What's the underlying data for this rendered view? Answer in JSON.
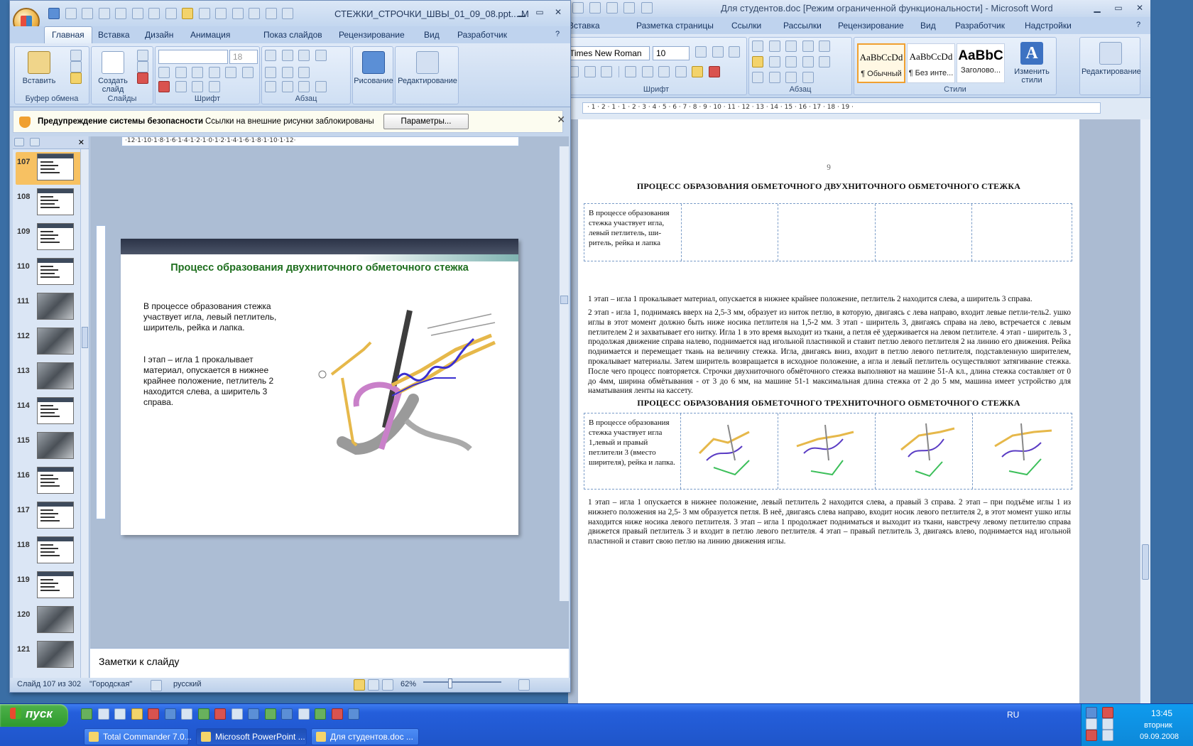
{
  "word": {
    "title": "Для студентов.doc [Режим ограниченной функциональности] - Microsoft Word",
    "tabs": [
      "Вставка",
      "Разметка страницы",
      "Ссылки",
      "Рассылки",
      "Рецензирование",
      "Вид",
      "Разработчик",
      "Надстройки"
    ],
    "font_name": "Times New Roman",
    "font_size": "10",
    "styles": [
      {
        "sample": "AaBbCcDd",
        "name": "¶ Обычный"
      },
      {
        "sample": "AaBbCcDd",
        "name": "¶ Без инте..."
      },
      {
        "sample": "AaBbC",
        "name": "Заголово..."
      }
    ],
    "change_styles": "Изменить стили",
    "editing": "Редактирование",
    "groups": {
      "font": "Шрифт",
      "paragraph": "Абзац",
      "styles": "Стили"
    },
    "ruler": "· 1 · 2 · 1 · 1 · 2 · 3 · 4 · 5 · 6 · 7 · 8 · 9 · 10 · 11 · 12 · 13 · 14 · 15 · 16 · 17 · 18 · 19 ·",
    "page_number": "9",
    "heading1": "ПРОЦЕСС ОБРАЗОВАНИЯ ОБМЕТОЧНОГО ДВУХНИТОЧНОГО ОБМЕТОЧНОГО СТЕЖКА",
    "table1_text": "В процессе образования стежка участвует игла, левый петлитель, ши-ритель, рейка и лапка",
    "para1": "1 этап – игла 1 прокалывает материал, опускается в нижнее крайнее положение, петлитель 2 находится слева, а ширитель 3 справа.",
    "para2": "2 этап - игла 1, поднимаясь вверх на 2,5-3 мм, образует из ниток петлю, в которую, двигаясь с лева направо, входит левые петли-тель2. ушко иглы в этот момент должно быть ниже носика петлителя на 1,5-2 мм. 3 этап - ширитель 3, двигаясь справа на лево, встречается с левым петлителем 2 и захватывает его нитку. Игла 1 в это время выходит из ткани, а петля её удерживается на левом петлителе. 4 этап - ширитель 3 , продолжая движение справа налево, поднимается над игольной пластинкой и ставит петлю левого петлителя 2 на линию его движения. Рейка поднимается и перемещает ткань на величину стежка. Игла, двигаясь вниз, входит в петлю левого петлителя, подставленную ширителем, прокалывает материалы. Затем ширитель возвращается в исходное положение, а игла и левый петлитель осуществляют затягивание стежка. После чего процесс повторяется. Строчки двухниточного обмёточного стежка выполняют на машине 51-А кл., длина стежка составляет от 0 до 4мм, ширина обмётывания - от 3 до 6 мм, на машине 51-1 максимальная длина стежка от 2 до 5 мм, машина имеет устройство для наматывания ленты на кассету.",
    "heading2": "ПРОЦЕСС ОБРАЗОВАНИЯ ОБМЕТОЧНОГО ТРЕХНИТОЧНОГО ОБМЕТОЧНОГО СТЕЖКА",
    "table2_text": "В процессе образования стежка участвует игла 1,левый и правый петлители 3 (вместо ширителя), рейка и лапка.",
    "para3": "1 этап – игла 1 опускается в нижнее положение, левый петлитель 2 находится слева, а правый 3 справа. 2 этап – при подъёме иглы 1 из нижнего положения на 2,5- 3 мм образуется петля. В неё, двигаясь слева направо, входит носик левого петлителя 2, в этот момент ушко иглы находится ниже носика левого петлителя. 3 этап – игла 1 продолжает подниматься и выходит из ткани, навстречу левому петлителю справа движется правый петлитель 3 и входит в петлю левого петлителя. 4 этап – правый петлитель 3, двигаясь влево, поднимается над игольной пластиной и ставит свою петлю на линию движения иглы."
  },
  "ppt": {
    "title": "СТЕЖКИ_СТРОЧКИ_ШВЫ_01_09_08.ppt...",
    "title_suffix": "M",
    "tabs": [
      "Главная",
      "Вставка",
      "Дизайн",
      "Анимация",
      "Показ слайдов",
      "Рецензирование",
      "Вид",
      "Разработчик"
    ],
    "ribbon": {
      "paste": "Вставить",
      "clipboard": "Буфер обмена",
      "create_slide": "Создать слайд",
      "slides": "Слайды",
      "font_size": "18",
      "font": "Шрифт",
      "paragraph": "Абзац",
      "drawing": "Рисование",
      "editing": "Редактирование"
    },
    "security_title": "Предупреждение системы безопасности",
    "security_msg": "Ссылки на внешние рисунки заблокированы",
    "security_btn": "Параметры...",
    "thumbnails": [
      "107",
      "108",
      "109",
      "110",
      "111",
      "112",
      "113",
      "114",
      "115",
      "116",
      "117",
      "118",
      "119",
      "120",
      "121"
    ],
    "ruler": "·12·1·10·1·8·1·6·1·4·1·2·1·0·1·2·1·4·1·6·1·8·1·10·1·12·",
    "slide_title": "Процесс образования двухниточного обметочного стежка",
    "slide_text1": "В процессе образования стежка участвует игла, левый петлитель, ширитель, рейка и лапка.",
    "slide_text2": "I этап – игла 1 прокалывает материал, опускается в нижнее крайнее положение, петлитель 2 находится слева, а ширитель 3 справа.",
    "notes": "Заметки к слайду",
    "status": {
      "slide": "Слайд 107 из 302",
      "theme": "\"Городская\"",
      "lang": "русский",
      "zoom": "62%"
    }
  },
  "taskbar": {
    "start": "пуск",
    "buttons": [
      "Total Commander 7.0...",
      "Microsoft PowerPoint ...",
      "Для студентов.doc ..."
    ],
    "lang": "RU",
    "time": "13:45",
    "day": "вторник",
    "date": "09.09.2008"
  }
}
